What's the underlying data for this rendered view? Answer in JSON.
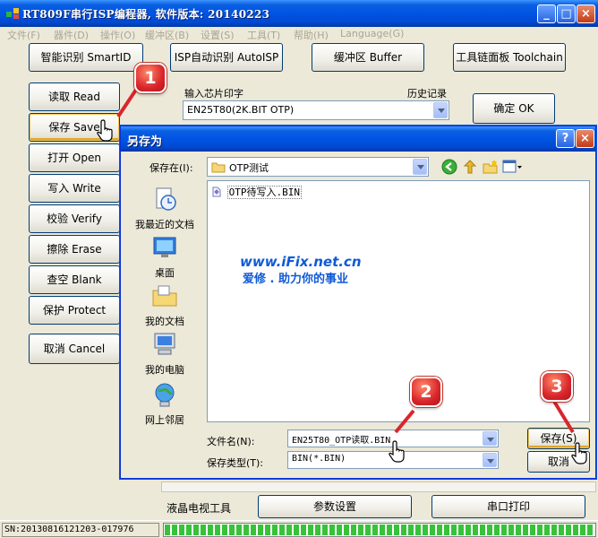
{
  "window": {
    "title": "RT809F串行ISP编程器, 软件版本: 20140223"
  },
  "menu": [
    "文件(F)",
    "器件(D)",
    "操作(O)",
    "缓冲区(B)",
    "设置(S)",
    "工具(T)",
    "帮助(H)",
    "Language(G)"
  ],
  "toolbar": {
    "smartid": "智能识别 SmartID",
    "isp_auto": "ISP自动识别 AutoISP",
    "buffer": "缓冲区 Buffer",
    "toolchain": "工具链面板 Toolchain"
  },
  "side_buttons": [
    {
      "label": "读取 Read"
    },
    {
      "label": "保存 Save"
    },
    {
      "label": "打开 Open"
    },
    {
      "label": "写入 Write"
    },
    {
      "label": "校验 Verify"
    },
    {
      "label": "擦除 Erase"
    },
    {
      "label": "查空 Blank"
    },
    {
      "label": "保护 Protect"
    },
    {
      "label": "取消 Cancel"
    }
  ],
  "chip": {
    "label": "输入芯片印字",
    "history_label": "历史记录",
    "value": "EN25T80(2K.BIT OTP)",
    "ok_button": "确定 OK"
  },
  "bottom": {
    "lcd_tool": "液晶电视工具",
    "params": "参数设置",
    "serial_print": "串口打印"
  },
  "status": {
    "sn": "SN:20130816121203-017976",
    "progress": 1.0
  },
  "dialog": {
    "title": "另存为",
    "save_in_label": "保存在(I):",
    "save_in_value": "OTP测试",
    "places": [
      "我最近的文档",
      "桌面",
      "我的文档",
      "我的电脑",
      "网上邻居"
    ],
    "files": [
      "OTP待写入.BIN"
    ],
    "filename_label": "文件名(N):",
    "filename_value": "EN25T80_OTP读取.BIN",
    "filetype_label": "保存类型(T):",
    "filetype_value": "BIN(*.BIN)",
    "save_button": "保存(S)",
    "cancel_button": "取消"
  },
  "watermark": {
    "line1": "www.iFix.net.cn",
    "line2": "爱修 . 助力你的事业"
  },
  "annotations": [
    "1",
    "2",
    "3"
  ],
  "colors": {
    "titlebar": "#0054e3",
    "badge": "#d9262c",
    "progress": "#37c23a",
    "watermark": "#0f5ad6"
  }
}
